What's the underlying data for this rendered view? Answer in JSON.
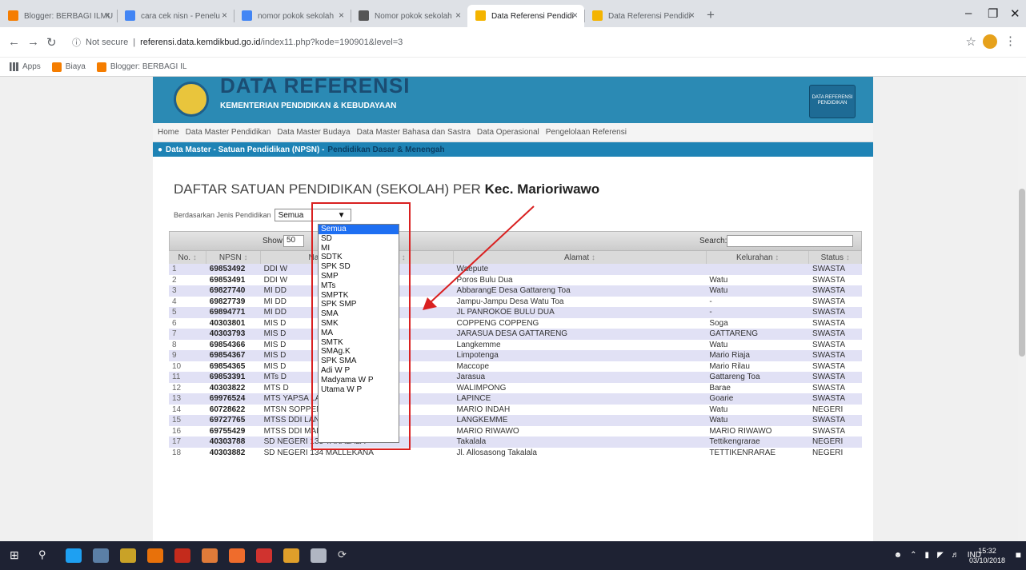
{
  "browser": {
    "tabs": [
      {
        "label": "Blogger: BERBAGI ILMU",
        "color": "#f57d00"
      },
      {
        "label": "cara cek nisn - Penelu",
        "color": "#4285f4"
      },
      {
        "label": "nomor pokok sekolah",
        "color": "#4285f4"
      },
      {
        "label": "Nomor pokok sekolah",
        "color": "#555555"
      },
      {
        "label": "Data Referensi Pendidi",
        "color": "#f4b400"
      },
      {
        "label": "Data Referensi Pendidi",
        "color": "#f4b400"
      }
    ],
    "active_tab": 4,
    "url_secure": "Not secure",
    "url_host": "referensi.data.kemdikbud.go.id",
    "url_path": "/index11.php?kode=190901&level=3",
    "bookmarks": [
      {
        "label": "Apps",
        "icon": "apps-grid-icon"
      },
      {
        "label": "Biaya",
        "icon": "blogger-icon"
      },
      {
        "label": "Blogger: BERBAGI IL",
        "icon": "blogger-icon"
      }
    ]
  },
  "site": {
    "title": "DATA REFERENSI",
    "subtitle": "KEMENTERIAN PENDIDIKAN & KEBUDAYAAN",
    "badge": "DATA REFERENSI PENDIDIKAN",
    "nav": [
      "Home",
      "Data Master Pendidikan",
      "Data Master Budaya",
      "Data Master Bahasa dan Sastra",
      "Data Operasional",
      "Pengelolaan Referensi"
    ],
    "breadcrumb": "Data Master - Satuan Pendidikan (NPSN) -",
    "breadcrumb_highlight": "Pendidikan Dasar & Menengah",
    "heading": "DAFTAR SATUAN PENDIDIKAN (SEKOLAH) PER",
    "heading_bold": "Kec. Marioriwawo",
    "filter_label": "Berdasarkan Jenis Pendidikan",
    "filter_value": "Semua",
    "show_label": "Show",
    "show_value": "50",
    "search_label": "Search:"
  },
  "dropdown": {
    "options": [
      "Semua",
      "SD",
      "MI",
      "SDTK",
      "SPK SD",
      "SMP",
      "MTs",
      "SMPTK",
      "SPK SMP",
      "SMA",
      "SMK",
      "MA",
      "SMTK",
      "SMAg.K",
      "SPK SMA",
      "Adi W P",
      "Madyama W P",
      "Utama W P"
    ],
    "selected": 0
  },
  "table": {
    "columns": [
      "No.",
      "NPSN",
      "Nama Satuan Pendidikan",
      "Alamat",
      "Kelurahan",
      "Status"
    ],
    "rows": [
      [
        "1",
        "69853492",
        "DDI W",
        "Waepute",
        "",
        "SWASTA"
      ],
      [
        "2",
        "69853491",
        "DDI W",
        "Poros Bulu Dua",
        "Watu",
        "SWASTA"
      ],
      [
        "3",
        "69827740",
        "MI DD",
        "AbbarangE Desa Gattareng Toa",
        "Watu",
        "SWASTA"
      ],
      [
        "4",
        "69827739",
        "MI DD",
        "Jampu-Jampu Desa Watu Toa",
        "-",
        "SWASTA"
      ],
      [
        "5",
        "69894771",
        "MI DD",
        "JL PANROKOE BULU DUA",
        "-",
        "SWASTA"
      ],
      [
        "6",
        "40303801",
        "MIS D",
        "COPPENG COPPENG",
        "Soga",
        "SWASTA"
      ],
      [
        "7",
        "40303793",
        "MIS D",
        "JARASUA DESA GATTARENG",
        "GATTARENG",
        "SWASTA"
      ],
      [
        "8",
        "69854366",
        "MIS D",
        "Langkemme",
        "Watu",
        "SWASTA"
      ],
      [
        "9",
        "69854367",
        "MIS D",
        "Limpotenga",
        "Mario Riaja",
        "SWASTA"
      ],
      [
        "10",
        "69854365",
        "MIS D",
        "Maccope",
        "Mario Rilau",
        "SWASTA"
      ],
      [
        "11",
        "69853391",
        "MTs D",
        "Jarasua",
        "Gattareng Toa",
        "SWASTA"
      ],
      [
        "12",
        "40303822",
        "MTS D",
        "WALIMPONG",
        "Barae",
        "SWASTA"
      ],
      [
        "13",
        "69976524",
        "MTS YAPSA LAPINCE",
        "LAPINCE",
        "Goarie",
        "SWASTA"
      ],
      [
        "14",
        "60728622",
        "MTSN SOPPENG",
        "MARIO INDAH",
        "Watu",
        "NEGERI"
      ],
      [
        "15",
        "69727765",
        "MTSS DDI LANGKEMME",
        "LANGKEMME",
        "Watu",
        "SWASTA"
      ],
      [
        "16",
        "69755429",
        "MTSS DDI MALONGKA",
        "MARIO RIWAWO",
        "MARIO RIWAWO",
        "SWASTA"
      ],
      [
        "17",
        "40303788",
        "SD NEGERI 133 TAKALALA",
        "Takalala",
        "Tettikengrarae",
        "NEGERI"
      ],
      [
        "18",
        "40303882",
        "SD NEGERI 134 MALLEKANA",
        "Jl. Allosasong Takalala",
        "TETTIKENRARAE",
        "NEGERI"
      ]
    ]
  },
  "taskbar": {
    "lang": "IND",
    "time": "15:32",
    "date": "03/10/2018"
  }
}
